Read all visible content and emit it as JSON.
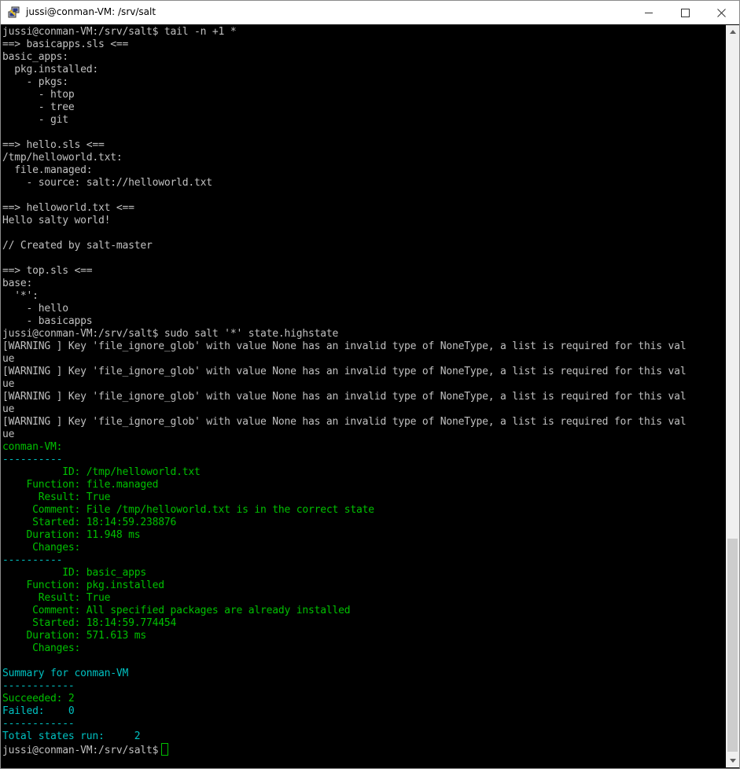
{
  "window": {
    "title": "jussi@conman-VM: /srv/salt",
    "controls": [
      "minimize",
      "maximize",
      "close"
    ]
  },
  "terminal": {
    "colors": {
      "default": "#c0c0c0",
      "green": "#00c000",
      "cyan": "#00c0c0"
    },
    "lines": [
      {
        "text": "jussi@conman-VM:/srv/salt$ tail -n +1 *",
        "color": "default"
      },
      {
        "text": "==> basicapps.sls <==",
        "color": "default"
      },
      {
        "text": "basic_apps:",
        "color": "default"
      },
      {
        "text": "  pkg.installed:",
        "color": "default"
      },
      {
        "text": "    - pkgs:",
        "color": "default"
      },
      {
        "text": "      - htop",
        "color": "default"
      },
      {
        "text": "      - tree",
        "color": "default"
      },
      {
        "text": "      - git",
        "color": "default"
      },
      {
        "text": "",
        "color": "default"
      },
      {
        "text": "==> hello.sls <==",
        "color": "default"
      },
      {
        "text": "/tmp/helloworld.txt:",
        "color": "default"
      },
      {
        "text": "  file.managed:",
        "color": "default"
      },
      {
        "text": "    - source: salt://helloworld.txt",
        "color": "default"
      },
      {
        "text": "",
        "color": "default"
      },
      {
        "text": "==> helloworld.txt <==",
        "color": "default"
      },
      {
        "text": "Hello salty world!",
        "color": "default"
      },
      {
        "text": "",
        "color": "default"
      },
      {
        "text": "// Created by salt-master",
        "color": "default"
      },
      {
        "text": "",
        "color": "default"
      },
      {
        "text": "==> top.sls <==",
        "color": "default"
      },
      {
        "text": "base:",
        "color": "default"
      },
      {
        "text": "  '*':",
        "color": "default"
      },
      {
        "text": "    - hello",
        "color": "default"
      },
      {
        "text": "    - basicapps",
        "color": "default"
      },
      {
        "text": "jussi@conman-VM:/srv/salt$ sudo salt '*' state.highstate",
        "color": "default"
      },
      {
        "text": "[WARNING ] Key 'file_ignore_glob' with value None has an invalid type of NoneType, a list is required for this val",
        "color": "default"
      },
      {
        "text": "ue",
        "color": "default"
      },
      {
        "text": "[WARNING ] Key 'file_ignore_glob' with value None has an invalid type of NoneType, a list is required for this val",
        "color": "default"
      },
      {
        "text": "ue",
        "color": "default"
      },
      {
        "text": "[WARNING ] Key 'file_ignore_glob' with value None has an invalid type of NoneType, a list is required for this val",
        "color": "default"
      },
      {
        "text": "ue",
        "color": "default"
      },
      {
        "text": "[WARNING ] Key 'file_ignore_glob' with value None has an invalid type of NoneType, a list is required for this val",
        "color": "default"
      },
      {
        "text": "ue",
        "color": "default"
      },
      {
        "text": "conman-VM:",
        "color": "green"
      },
      {
        "text": "----------",
        "color": "cyan"
      },
      {
        "text": "          ID: /tmp/helloworld.txt",
        "color": "green"
      },
      {
        "text": "    Function: file.managed",
        "color": "green"
      },
      {
        "text": "      Result: True",
        "color": "green"
      },
      {
        "text": "     Comment: File /tmp/helloworld.txt is in the correct state",
        "color": "green"
      },
      {
        "text": "     Started: 18:14:59.238876",
        "color": "green"
      },
      {
        "text": "    Duration: 11.948 ms",
        "color": "green"
      },
      {
        "text": "     Changes:",
        "color": "green"
      },
      {
        "text": "----------",
        "color": "cyan"
      },
      {
        "text": "          ID: basic_apps",
        "color": "green"
      },
      {
        "text": "    Function: pkg.installed",
        "color": "green"
      },
      {
        "text": "      Result: True",
        "color": "green"
      },
      {
        "text": "     Comment: All specified packages are already installed",
        "color": "green"
      },
      {
        "text": "     Started: 18:14:59.774454",
        "color": "green"
      },
      {
        "text": "    Duration: 571.613 ms",
        "color": "green"
      },
      {
        "text": "     Changes:",
        "color": "green"
      },
      {
        "text": "",
        "color": "default"
      },
      {
        "text": "Summary for conman-VM",
        "color": "cyan"
      },
      {
        "text": "------------",
        "color": "cyan"
      },
      {
        "text": "Succeeded: 2",
        "color": "green"
      },
      {
        "text": "Failed:    0",
        "color": "cyan"
      },
      {
        "text": "------------",
        "color": "cyan"
      },
      {
        "text": "Total states run:     2",
        "color": "cyan"
      }
    ],
    "prompt": "jussi@conman-VM:/srv/salt$"
  }
}
